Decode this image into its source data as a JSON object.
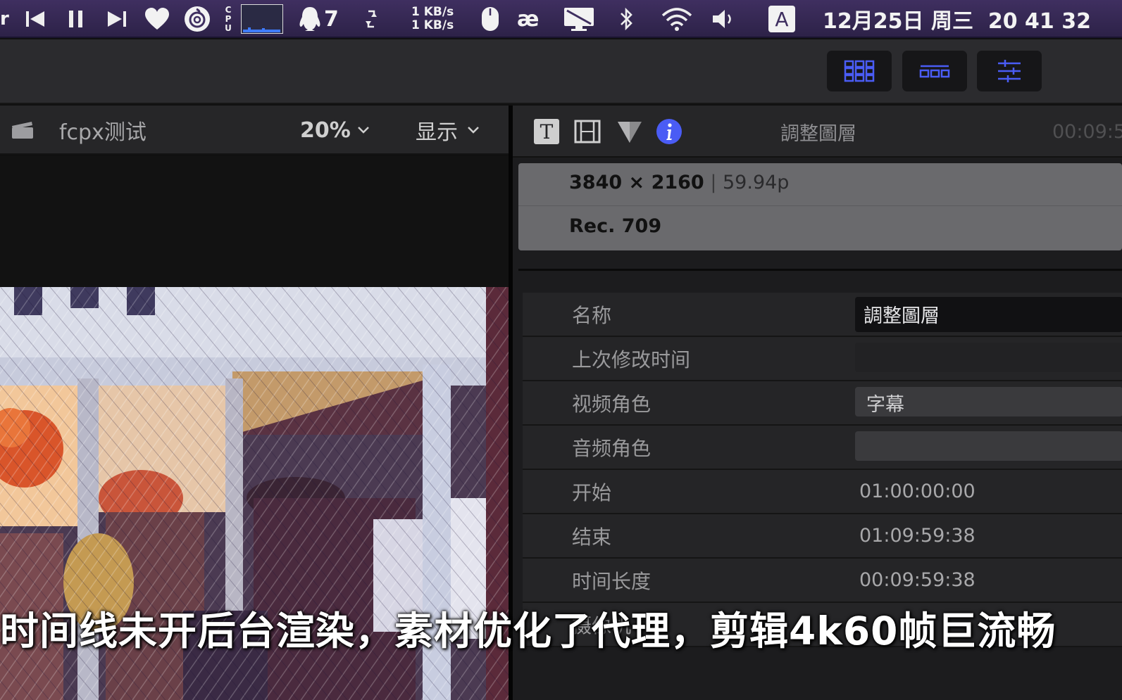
{
  "menubar": {
    "net_up": "1 KB/s",
    "net_down": "1 KB/s",
    "cpu_label": "C P U",
    "notif_count": "7",
    "input_ae": "æ",
    "input_method": "A",
    "datetime": "12月25日 周三  20 41 32"
  },
  "viewer": {
    "project_name": "fcpx测试",
    "zoom": "20%",
    "display_menu": "显示"
  },
  "inspector": {
    "title": "調整圖層",
    "timecode": "00:09:5",
    "resolution": "3840 × 2160",
    "framerate": "59.94p",
    "colorspace": "Rec. 709",
    "properties": [
      {
        "label": "名称",
        "value": "調整圖層",
        "style": "input"
      },
      {
        "label": "上次修改时间",
        "value": "",
        "style": "plain"
      },
      {
        "label": "视频角色",
        "value": "字幕",
        "style": "dropdown"
      },
      {
        "label": "音频角色",
        "value": "",
        "style": "dropdown"
      },
      {
        "label": "开始",
        "value": "01:00:00:00",
        "style": "plain"
      },
      {
        "label": "结束",
        "value": "01:09:59:38",
        "style": "plain"
      },
      {
        "label": "时间长度",
        "value": "00:09:59:38",
        "style": "plain"
      },
      {
        "label": "摄像机",
        "value": "",
        "style": "plain"
      }
    ]
  },
  "caption": "时间线未开后台渲染，素材优化了代理，剪辑4k60帧巨流畅",
  "colors": {
    "menubar": "#3f2f60",
    "accent_blue": "#4a5cf5",
    "panel": "#262628"
  }
}
